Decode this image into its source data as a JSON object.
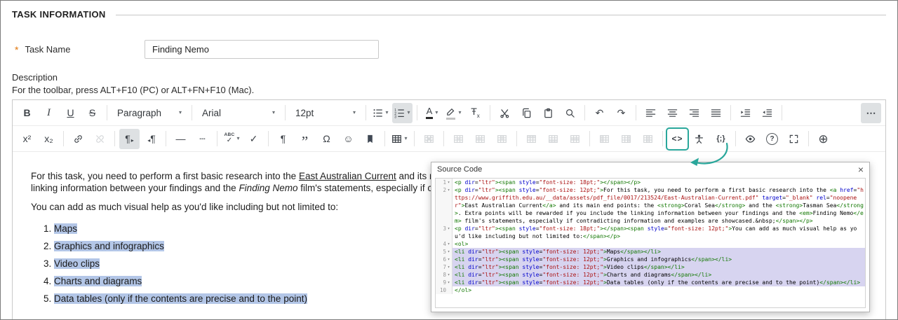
{
  "page": {
    "title": "TASK INFORMATION"
  },
  "task_name": {
    "required_marker": "*",
    "label": "Task Name",
    "value": "Finding Nemo"
  },
  "description": {
    "label": "Description",
    "toolbar_hint": "For the toolbar, press ALT+F10 (PC) or ALT+FN+F10 (Mac)."
  },
  "toolbar": {
    "chevron": "▾",
    "selects": {
      "paragraph": "Paragraph",
      "font": "Arial",
      "fontsize": "12pt"
    },
    "rows": [
      [
        [
          {
            "name": "bold",
            "icon": "bold"
          },
          {
            "name": "italic",
            "icon": "italic"
          },
          {
            "name": "underline",
            "icon": "underline"
          },
          {
            "name": "strikethrough",
            "icon": "strikethrough"
          }
        ],
        [
          {
            "name": "paragraph-format",
            "type": "select",
            "value": "Paragraph"
          }
        ],
        [
          {
            "name": "font-family",
            "type": "select",
            "value": "Arial"
          }
        ],
        [
          {
            "name": "font-size",
            "type": "select",
            "value": "12pt"
          }
        ],
        [
          {
            "name": "bullet-list",
            "icon": "bullet-list",
            "chevron": true
          },
          {
            "name": "numbered-list",
            "icon": "numbered-list",
            "chevron": true,
            "active": true
          }
        ],
        [
          {
            "name": "text-color",
            "icon": "text-color",
            "chevron": true
          },
          {
            "name": "highlight-color",
            "icon": "highlight-color",
            "chevron": true
          },
          {
            "name": "clear-formatting",
            "icon": "clear-formatting"
          }
        ],
        [
          {
            "name": "cut",
            "icon": "cut"
          },
          {
            "name": "copy",
            "icon": "copy"
          },
          {
            "name": "paste",
            "icon": "paste"
          },
          {
            "name": "search",
            "icon": "search"
          }
        ],
        [
          {
            "name": "undo",
            "icon": "undo"
          },
          {
            "name": "redo",
            "icon": "redo"
          }
        ],
        [
          {
            "name": "align-left",
            "icon": "align-left"
          },
          {
            "name": "align-center",
            "icon": "align-center"
          },
          {
            "name": "align-right",
            "icon": "align-right"
          },
          {
            "name": "align-justify",
            "icon": "align-justify"
          }
        ],
        [
          {
            "name": "indent",
            "icon": "indent"
          },
          {
            "name": "outdent",
            "icon": "outdent"
          }
        ],
        [
          {
            "name": "more-options",
            "icon": "more",
            "active": true,
            "push": true
          }
        ]
      ],
      [
        [
          {
            "name": "superscript",
            "icon": "superscript"
          },
          {
            "name": "subscript",
            "icon": "subscript"
          }
        ],
        [
          {
            "name": "insert-link",
            "icon": "link"
          },
          {
            "name": "remove-link",
            "icon": "unlink",
            "disabled": true
          }
        ],
        [
          {
            "name": "ltr-direction",
            "icon": "ltr",
            "active": true
          },
          {
            "name": "rtl-direction",
            "icon": "rtl"
          }
        ],
        [
          {
            "name": "horizontal-rule",
            "icon": "horizontal-rule"
          },
          {
            "name": "page-break",
            "icon": "page-break"
          }
        ],
        [
          {
            "name": "spell-check",
            "icon": "spell-check",
            "chevron": true
          },
          {
            "name": "spell-check-toggle",
            "icon": "check"
          }
        ],
        [
          {
            "name": "paragraph-mark",
            "icon": "paragraph-mark"
          },
          {
            "name": "blockquote",
            "icon": "blockquote"
          },
          {
            "name": "special-character",
            "icon": "special-character"
          },
          {
            "name": "emoticons",
            "icon": "emoticons"
          },
          {
            "name": "anchor",
            "icon": "anchor"
          }
        ],
        [
          {
            "name": "insert-table",
            "icon": "table",
            "chevron": true
          }
        ],
        [
          {
            "name": "delete-table",
            "icon": "table-delete",
            "disabled": true
          }
        ],
        [
          {
            "name": "cell-properties",
            "icon": "table-cell",
            "disabled": true
          },
          {
            "name": "merge-cells",
            "icon": "table-merge",
            "disabled": true
          },
          {
            "name": "split-cell",
            "icon": "table-split",
            "disabled": true
          }
        ],
        [
          {
            "name": "insert-row-above",
            "icon": "table-row-above",
            "disabled": true
          },
          {
            "name": "insert-row-below",
            "icon": "table-row-below",
            "disabled": true
          },
          {
            "name": "delete-row",
            "icon": "table-row-delete",
            "disabled": true
          }
        ],
        [
          {
            "name": "insert-column-before",
            "icon": "table-col-before",
            "disabled": true
          },
          {
            "name": "insert-column-after",
            "icon": "table-col-after",
            "disabled": true
          },
          {
            "name": "delete-column",
            "icon": "table-col-delete",
            "disabled": true
          }
        ],
        [
          {
            "name": "source-code",
            "icon": "source-code",
            "annotated": true
          },
          {
            "name": "accessibility-checker",
            "icon": "accessibility"
          },
          {
            "name": "code-sample",
            "icon": "code-sample"
          }
        ],
        [
          {
            "name": "preview",
            "icon": "preview"
          },
          {
            "name": "help",
            "icon": "help"
          },
          {
            "name": "fullscreen",
            "icon": "fullscreen"
          }
        ],
        [
          {
            "name": "insert",
            "icon": "insert-plus"
          }
        ]
      ]
    ]
  },
  "editor": {
    "paragraph1": [
      {
        "text": "For this task, you need to perform a first basic research into the ",
        "style": "plain"
      },
      {
        "text": "East Australian Current",
        "style": "link"
      },
      {
        "text": " and its main end points: the ",
        "style": "plain"
      },
      {
        "text": "Coral Sea",
        "style": "bold"
      },
      {
        "text": " and the ",
        "style": "plain"
      },
      {
        "text": "Tasman Sea",
        "style": "bold"
      },
      {
        "text": ". Extra points will be rewarded if you include the linking information between your findings and the ",
        "style": "plain"
      },
      {
        "text": "Finding Nemo",
        "style": "italic"
      },
      {
        "text": " film's statements, especially if contradicting information and examples are showcased.",
        "style": "plain"
      }
    ],
    "paragraph2": "You can add as much visual help as you'd like including but not limited to:",
    "list_items": [
      {
        "text": "Maps",
        "selected": true
      },
      {
        "text": "Graphics and infographics",
        "selected": true
      },
      {
        "text": "Video clips",
        "selected": true
      },
      {
        "text": "Charts and diagrams",
        "selected": true
      },
      {
        "text": "Data tables (only if the contents are precise and to the point)",
        "selected": true
      }
    ]
  },
  "source_code_panel": {
    "title": "Source Code",
    "close_symbol": "×",
    "fold_symbol": "▾",
    "lines": [
      {
        "n": 1,
        "fold": true,
        "selected": false,
        "code": "<p dir=\"ltr\"><span style=\"font-size: 18pt;\"></span></p>"
      },
      {
        "n": 2,
        "fold": true,
        "selected": false,
        "code": "<p dir=\"ltr\"><span style=\"font-size: 12pt;\">For this task, you need to perform a first basic research into the <a href=\"https://www.griffith.edu.au/__data/assets/pdf_file/0017/213524/East-Australian-Current.pdf\" target=\"_blank\" rel=\"noopener\">East Australian Current</a> and its main end points: the <strong>Coral Sea</strong> and the <strong>Tasman Sea</strong>. Extra points will be rewarded if you include the linking information between your findings and the <em>Finding Nemo</em> film's statements, especially if contradicting information and examples are showcased.&nbsp;</span></p>"
      },
      {
        "n": 3,
        "fold": true,
        "selected": false,
        "code": "<p dir=\"ltr\"><span style=\"font-size: 18pt;\"></span><span style=\"font-size: 12pt;\">You can add as much visual help as you'd like including but not limited to:</span></p>"
      },
      {
        "n": 4,
        "fold": true,
        "selected": false,
        "code": "<ol>"
      },
      {
        "n": 5,
        "fold": true,
        "selected": true,
        "code": "<li dir=\"ltr\"><span style=\"font-size: 12pt;\">Maps</span></li>"
      },
      {
        "n": 6,
        "fold": true,
        "selected": true,
        "code": "<li dir=\"ltr\"><span style=\"font-size: 12pt;\">Graphics and infographics</span></li>"
      },
      {
        "n": 7,
        "fold": true,
        "selected": true,
        "code": "<li dir=\"ltr\"><span style=\"font-size: 12pt;\">Video clips</span></li>"
      },
      {
        "n": 8,
        "fold": true,
        "selected": true,
        "code": "<li dir=\"ltr\"><span style=\"font-size: 12pt;\">Charts and diagrams</span></li>"
      },
      {
        "n": 9,
        "fold": true,
        "selected": true,
        "code": "<li dir=\"ltr\"><span style=\"font-size: 12pt;\">Data tables (only if the contents are precise and to the point)</span></li>"
      },
      {
        "n": 10,
        "fold": false,
        "selected": false,
        "code": "</ol>"
      }
    ]
  },
  "colors": {
    "annotation": "#2aa79b",
    "selection_editor": "#b3c6e7",
    "selection_code": "#d7d4f0",
    "required": "#e0760c",
    "code_tag": "#117700",
    "code_attribute": "#0000cc",
    "code_string": "#aa1111"
  }
}
